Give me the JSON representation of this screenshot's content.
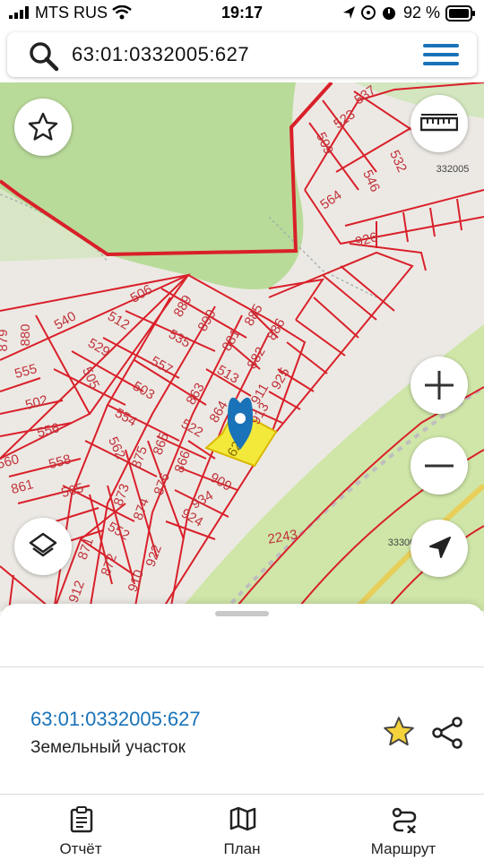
{
  "status_bar": {
    "carrier": "MTS RUS",
    "time": "19:17",
    "battery": "92 %"
  },
  "search": {
    "value": "63:01:0332005:627"
  },
  "map": {
    "labels": {
      "l537": "537",
      "l523": "523",
      "l509": "509",
      "l532": "532",
      "l546": "546",
      "l564": "564",
      "l926": "926",
      "l332005": "332005",
      "l506": "506",
      "l540": "540",
      "l512": "512",
      "l889": "889",
      "l890": "890",
      "l885": "885",
      "l535": "535",
      "l881": "881",
      "l882": "882",
      "l886": "886",
      "l529": "529",
      "l557": "557",
      "l513": "513",
      "l505": "505",
      "l503": "503",
      "l863": "863",
      "l925": "925",
      "l911": "911",
      "l913": "913",
      "l864": "864",
      "l554": "554",
      "l522": "522",
      "l627": "627",
      "l880": "880",
      "l879": "879",
      "l555": "555",
      "l502": "502",
      "l556": "556",
      "l558": "558",
      "l562": "562",
      "l865": "865",
      "l875": "875",
      "l866": "866",
      "l873": "873",
      "l876": "876",
      "l874": "874",
      "l909": "909",
      "l934": "934",
      "l924": "924",
      "l560": "560",
      "l861": "861",
      "l565": "565",
      "l552": "552",
      "l871": "871",
      "l872": "872",
      "l910": "910",
      "l922": "922",
      "l912": "912",
      "l2243": "2243",
      "l33300": "33300"
    },
    "colors": {
      "parcel_line": "#d9202a",
      "selected_fill": "#f2e93b",
      "forest": "#b9db9a",
      "road": "#cfe6a8",
      "marker": "#1a73b8"
    }
  },
  "controls": {
    "favorite_icon": "star-icon",
    "ruler_icon": "ruler-icon",
    "zoom_in_icon": "plus-icon",
    "zoom_out_icon": "minus-icon",
    "layers_icon": "layers-icon",
    "locate_icon": "navigation-arrow-icon"
  },
  "sheet": {
    "title": "63:01:0332005:627",
    "subtitle": "Земельный участок"
  },
  "tabs": [
    {
      "label": "Отчёт",
      "icon": "clipboard-icon"
    },
    {
      "label": "План",
      "icon": "map-icon"
    },
    {
      "label": "Маршрут",
      "icon": "route-icon"
    }
  ]
}
